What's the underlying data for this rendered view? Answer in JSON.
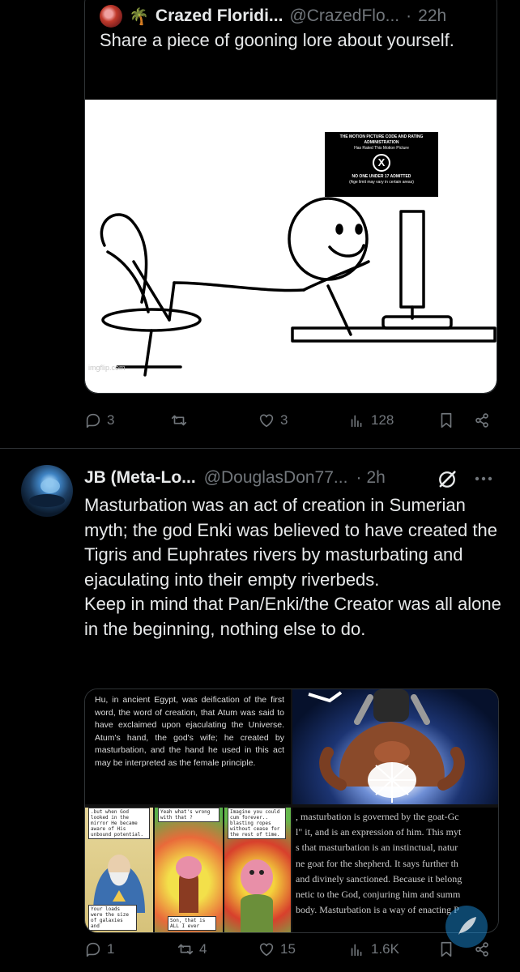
{
  "quoted_tweet": {
    "palm_emoji": "🌴",
    "name": "Crazed Floridi...",
    "handle": "@CrazedFlo...",
    "separator": "·",
    "time": "22h",
    "text": "Share a piece of gooning lore about yourself.",
    "image": {
      "rating_line1": "THE MOTION PICTURE CODE AND RATING ADMINISTRATION",
      "rating_line2": "Has Rated This Motion Picture",
      "rating_symbol": "X",
      "rating_line3": "NO ONE UNDER 17 ADMITTED",
      "rating_line4": "(Age limit may vary in certain areas)",
      "watermark": "imgflip.com"
    },
    "actions": {
      "replies": "3",
      "likes": "3",
      "views": "128"
    }
  },
  "tweet": {
    "name": "JB (Meta-Lo...",
    "handle": "@DouglasDon77...",
    "separator": "·",
    "time": "2h",
    "paragraph1": "Masturbation was an act of creation in Sumerian myth; the god Enki was believed to have created the Tigris and Euphrates rivers by masturbating and ejaculating into their empty riverbeds.",
    "paragraph2": "Keep in mind that Pan/Enki/the Creator was all alone in the beginning, nothing else to do.",
    "media": {
      "text_panel": "Hu, in ancient Egypt, was deification of the first word, the word of creation, that Atum was said to have exclaimed upon ejaculating the Universe. Atum's hand, the god's wife; he created by masturbation, and the hand he used in this act may be interpreted as the female principle.",
      "comic1_top": ".but when God looked in the mirror He became aware of His unbound potential.",
      "comic1_bottom": "Your loads were the size of galaxies and",
      "comic2_top": "Yeah what's wrong with that ?",
      "comic2_bottom": "Son, that is ALL I ever",
      "comic3_top": "Imagine you could cum forever.. blasting ropes without cease for the rest of time.",
      "serif_lines": [
        ", masturbation is governed by the goat-Gc",
        "l\" it, and is an expression of him.  This myt",
        "s that masturbation is an instinctual, natur",
        "ne goat for the shepherd.  It says further th",
        "and divinely sanctioned.  Because it belong",
        "netic to the God, conjuring him and summ",
        "body.  Masturbation is a way of enacting P"
      ]
    },
    "actions": {
      "replies": "1",
      "reposts": "4",
      "likes": "15",
      "views": "1.6K"
    }
  },
  "colors": {
    "background": "#000000",
    "text": "#e7e9ea",
    "muted": "#71767b",
    "border": "#2f3336"
  }
}
